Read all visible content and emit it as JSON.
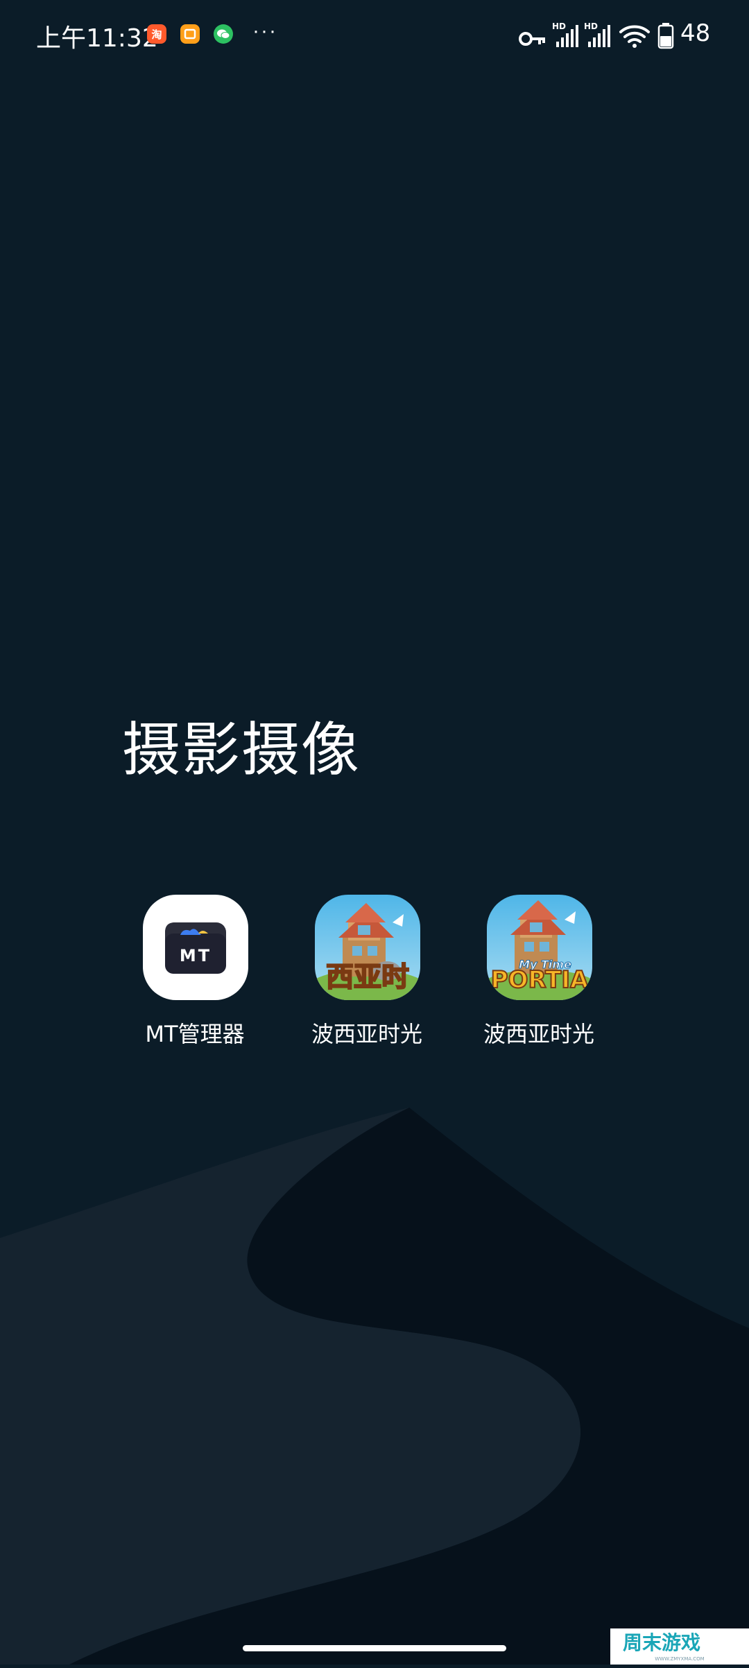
{
  "status_bar": {
    "time": "上午11:32",
    "notifications": [
      {
        "icon": "taobao-icon",
        "glyph": "淘",
        "color": "#ff5a2c"
      },
      {
        "icon": "orange-app-icon",
        "glyph": "□",
        "color": "#ff9f1a"
      },
      {
        "icon": "wechat-icon",
        "glyph": "✉",
        "color": "#2dc162"
      }
    ],
    "more": "···",
    "network_label_1": "HD",
    "network_label_2": "HD",
    "battery": "48"
  },
  "folder": {
    "title": "摄影摄像",
    "apps": [
      {
        "name": "MT管理器",
        "icon": "mt-manager-icon",
        "icon_text": "MT"
      },
      {
        "name": "波西亚时光",
        "icon": "my-time-at-portia-cn-icon",
        "icon_text": "西亚时"
      },
      {
        "name": "波西亚时光",
        "icon": "my-time-at-portia-en-icon",
        "icon_text": "PORTIA",
        "icon_subtext": "My Time"
      }
    ]
  },
  "watermark": {
    "text": "周末游戏",
    "subtext": "WWW.ZMYXMA.COM"
  },
  "colors": {
    "background": "#0b1c28",
    "dune_light": "#15232f",
    "dune_dark": "#06111b"
  }
}
